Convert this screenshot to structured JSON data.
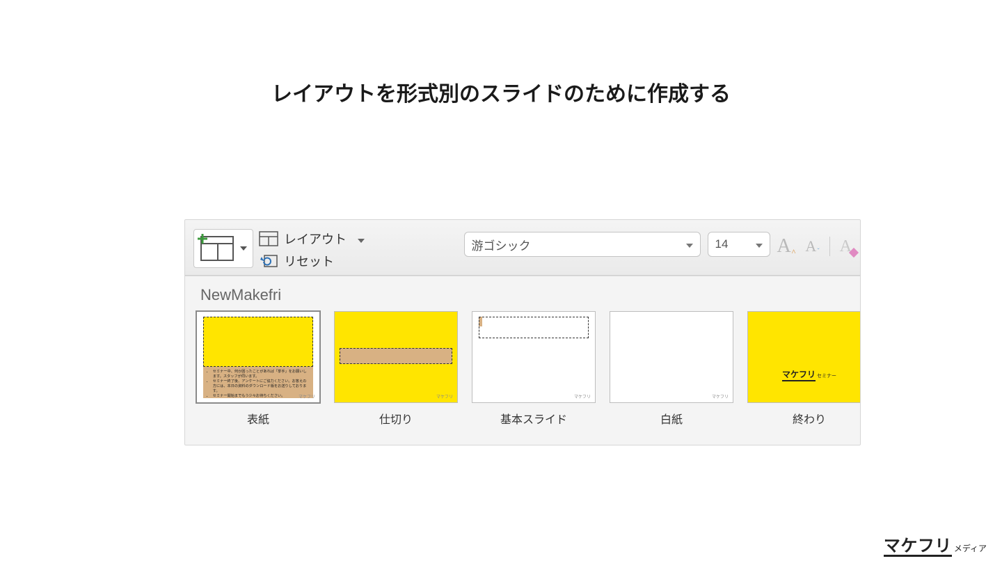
{
  "page_title": "レイアウトを形式別のスライドのために作成する",
  "ribbon": {
    "layout_label": "レイアウト",
    "reset_label": "リセット",
    "font_name": "游ゴシック",
    "font_size": "14"
  },
  "panel": {
    "theme_name": "NewMakefri",
    "layouts": [
      {
        "label": "表紙"
      },
      {
        "label": "仕切り"
      },
      {
        "label": "基本スライド"
      },
      {
        "label": "白紙"
      },
      {
        "label": "終わり"
      }
    ],
    "slide5_logo_main": "マケフリ",
    "slide5_logo_sub": "セミナー"
  },
  "watermark": {
    "main": "マケフリ",
    "sub": "メディア"
  }
}
